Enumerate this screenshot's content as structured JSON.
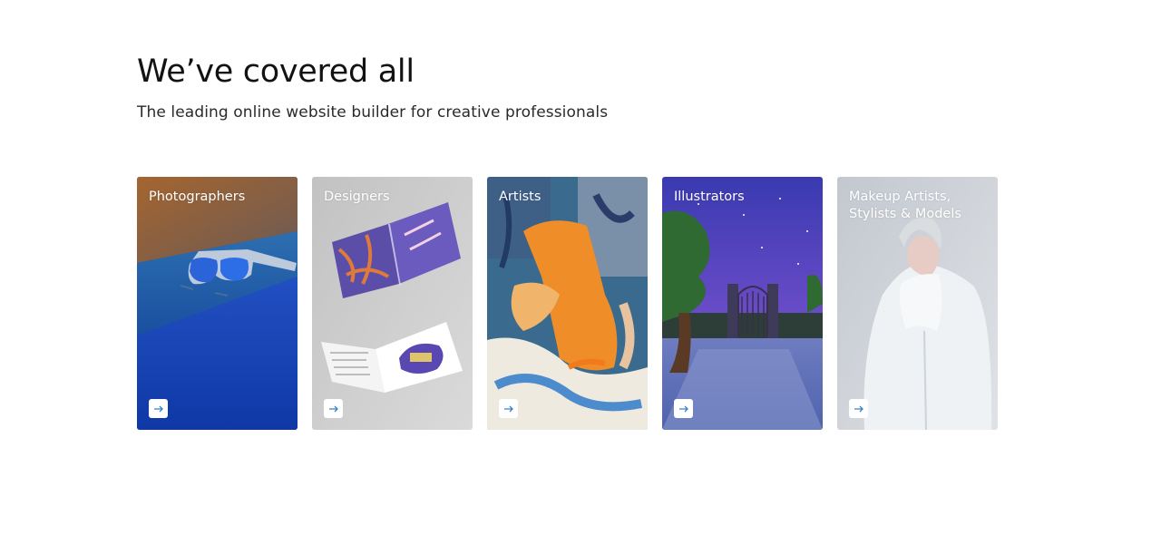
{
  "section": {
    "title": "We’ve covered all",
    "subtitle": "The leading online website builder for creative professionals"
  },
  "colors": {
    "arrow_accent": "#3b82c4",
    "photographers_bg": "#1f49b8",
    "designers_bg": "#cfcfcf",
    "artists_bg": "#e88a2a",
    "illustrators_bg": "#4b3fb4",
    "makeup_bg": "#cdd2d8"
  },
  "cards": [
    {
      "label": "Photographers",
      "icon": "arrow-right-icon"
    },
    {
      "label": "Designers",
      "icon": "arrow-right-icon"
    },
    {
      "label": "Artists",
      "icon": "arrow-right-icon"
    },
    {
      "label": "Illustrators",
      "icon": "arrow-right-icon"
    },
    {
      "label": "Makeup Artists,\nStylists & Models",
      "icon": "arrow-right-icon"
    }
  ]
}
